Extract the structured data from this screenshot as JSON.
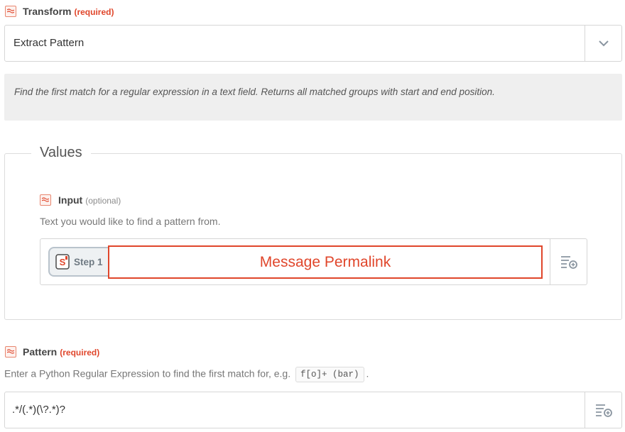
{
  "transform": {
    "label": "Transform",
    "required": "(required)",
    "selected": "Extract Pattern",
    "description": "Find the first match for a regular expression in a text field. Returns all matched groups with start and end position."
  },
  "values": {
    "legend": "Values",
    "input": {
      "label": "Input",
      "optional": "(optional)",
      "help": "Text you would like to find a pattern from.",
      "step_label": "Step 1",
      "value": "Message Permalink"
    }
  },
  "pattern": {
    "label": "Pattern",
    "required": "(required)",
    "help_prefix": "Enter a Python Regular Expression to find the first match for, e.g.",
    "example_code": "f[o]+ (bar)",
    "help_suffix": ".",
    "value": ".*/(.*)(\\?.*)?"
  },
  "colors": {
    "accent": "#e0462b",
    "icon_border": "#e8866f",
    "description_bg": "#efefef"
  },
  "icons": {
    "field_icon": "formatter-icon",
    "chevron": "chevron-down-icon",
    "insert": "insert-data-icon",
    "step_app": "slack-app-icon"
  }
}
